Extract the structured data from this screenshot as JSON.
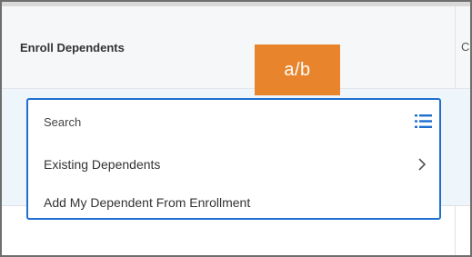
{
  "header": {
    "title": "Enroll Dependents",
    "next_column_letter": "C"
  },
  "badge": {
    "label": "a/b"
  },
  "dropdown": {
    "search_placeholder": "Search",
    "items": [
      {
        "label": "Existing Dependents"
      },
      {
        "label": "Add My Dependent From Enrollment"
      }
    ]
  },
  "colors": {
    "badge": "#e8852c",
    "focus_border": "#1f6fd1",
    "row_highlight": "#eef5fb"
  }
}
